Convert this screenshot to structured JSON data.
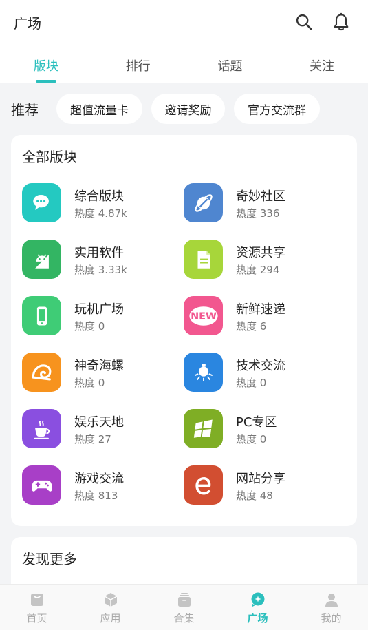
{
  "header": {
    "title": "广场"
  },
  "tabs": [
    {
      "label": "版块",
      "active": true
    },
    {
      "label": "排行",
      "active": false
    },
    {
      "label": "话题",
      "active": false
    },
    {
      "label": "关注",
      "active": false
    }
  ],
  "recommend": {
    "label": "推荐",
    "chips": [
      "超值流量卡",
      "邀请奖励",
      "官方交流群"
    ]
  },
  "all_boards": {
    "title": "全部版块",
    "items": [
      {
        "name": "综合版块",
        "heat": "热度 4.87k",
        "color": "#24c9c1",
        "icon": "chat-bubbles-icon"
      },
      {
        "name": "奇妙社区",
        "heat": "热度 336",
        "color": "#4f86d0",
        "icon": "planet-icon"
      },
      {
        "name": "实用软件",
        "heat": "热度 3.33k",
        "color": "#33b563",
        "icon": "android-icon"
      },
      {
        "name": "资源共享",
        "heat": "热度 294",
        "color": "#a7d63a",
        "icon": "document-icon"
      },
      {
        "name": "玩机广场",
        "heat": "热度 0",
        "color": "#3fcc76",
        "icon": "phone-icon"
      },
      {
        "name": "新鲜速递",
        "heat": "热度 6",
        "color": "#f2578f",
        "icon": "new-badge-icon"
      },
      {
        "name": "神奇海螺",
        "heat": "热度 0",
        "color": "#f7931e",
        "icon": "seashell-icon"
      },
      {
        "name": "技术交流",
        "heat": "热度 0",
        "color": "#2a86e0",
        "icon": "lightbulb-icon"
      },
      {
        "name": "娱乐天地",
        "heat": "热度 27",
        "color": "#8a4fe0",
        "icon": "coffee-cup-icon"
      },
      {
        "name": "PC专区",
        "heat": "热度 0",
        "color": "#7fae25",
        "icon": "windows-icon"
      },
      {
        "name": "游戏交流",
        "heat": "热度 813",
        "color": "#a83fc7",
        "icon": "gamepad-icon"
      },
      {
        "name": "网站分享",
        "heat": "热度 48",
        "color": "#d24e31",
        "icon": "ie-browser-icon"
      }
    ]
  },
  "discover": {
    "title": "发现更多"
  },
  "bottom_nav": [
    {
      "label": "首页",
      "icon": "home-icon",
      "active": false
    },
    {
      "label": "应用",
      "icon": "box-icon",
      "active": false
    },
    {
      "label": "合集",
      "icon": "collection-icon",
      "active": false
    },
    {
      "label": "广场",
      "icon": "square-chat-icon",
      "active": true
    },
    {
      "label": "我的",
      "icon": "person-icon",
      "active": false
    }
  ],
  "colors": {
    "accent": "#2bbfbd",
    "background": "#f3f4f6"
  }
}
